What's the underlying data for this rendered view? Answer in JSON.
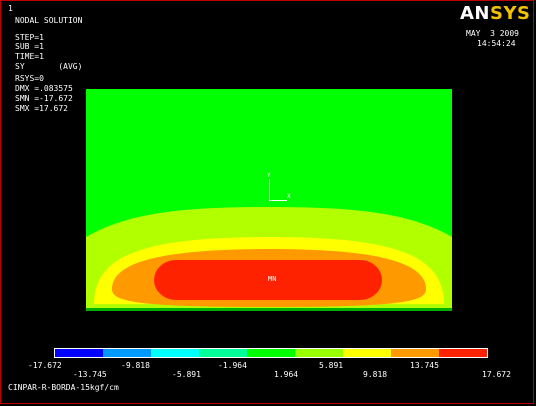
{
  "window_number": "1",
  "header": {
    "title": "NODAL SOLUTION",
    "info": [
      "STEP=1",
      "SUB =1",
      "TIME=1",
      "SY       (AVG)",
      "RSYS=0",
      "DMX =.083575",
      "SMN =-17.672",
      "SMX =17.672"
    ],
    "brand_an": "AN",
    "brand_sys": "SYS",
    "date": "MAY  3 2009",
    "time": "14:54:24"
  },
  "triad": {
    "y_label": "Y",
    "x_label": "X"
  },
  "plot": {
    "marker": "MN",
    "colors": {
      "background": "#00ff00",
      "band1": "#b2ff00",
      "band2": "#ffff00",
      "band3": "#ff9900",
      "band4": "#ff2200"
    }
  },
  "legend": {
    "colors": [
      "#0000ff",
      "#0099ff",
      "#00ffff",
      "#00ff99",
      "#00ff00",
      "#99ff00",
      "#ffff00",
      "#ff9900",
      "#ff2200"
    ],
    "ticks_bottom": [
      "-17.672",
      "-5.891",
      "1.964",
      "9.818",
      "17.672"
    ],
    "ticks_top": [
      "-13.745",
      "-9.818",
      "-1.964",
      "5.891",
      "13.745"
    ],
    "ticks_top_lower": [
      "-13.745"
    ]
  },
  "footer": {
    "caption": "CINPAR-R-BORDA-15kgf/cm"
  }
}
